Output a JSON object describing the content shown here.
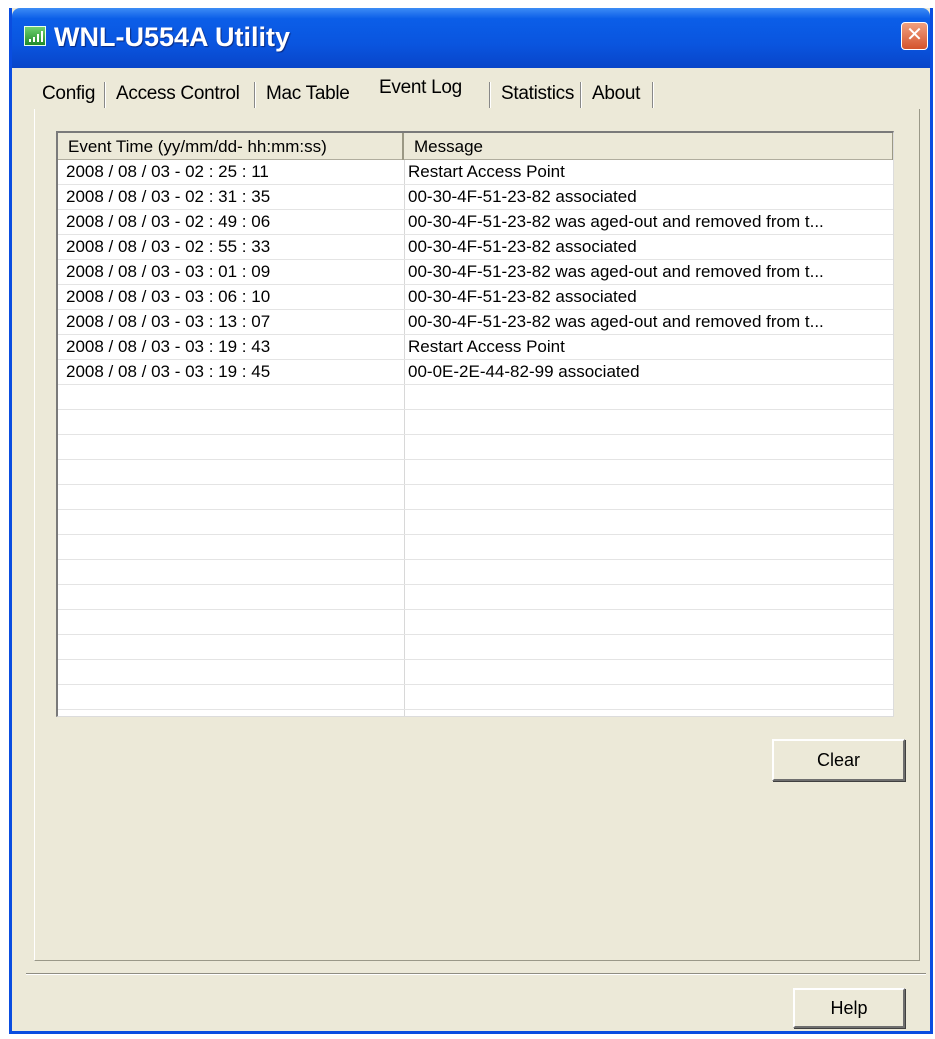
{
  "window": {
    "title": "WNL-U554A Utility",
    "close_glyph": "✕"
  },
  "tabs": [
    {
      "label": "Config"
    },
    {
      "label": "Access Control"
    },
    {
      "label": "Mac Table"
    },
    {
      "label": "Event Log",
      "active": true
    },
    {
      "label": "Statistics"
    },
    {
      "label": "About"
    }
  ],
  "event_log": {
    "columns": [
      "Event Time (yy/mm/dd- hh:mm:ss)",
      "Message"
    ],
    "rows": [
      {
        "time": "2008 / 08 / 03 - 02 : 25 : 11",
        "message": "Restart Access Point"
      },
      {
        "time": "2008 / 08 / 03 - 02 : 31 : 35",
        "message": "00-30-4F-51-23-82  associated"
      },
      {
        "time": "2008 / 08 / 03 - 02 : 49 : 06",
        "message": "00-30-4F-51-23-82  was aged-out and removed from t..."
      },
      {
        "time": "2008 / 08 / 03 - 02 : 55 : 33",
        "message": "00-30-4F-51-23-82  associated"
      },
      {
        "time": "2008 / 08 / 03 - 03 : 01 : 09",
        "message": "00-30-4F-51-23-82  was aged-out and removed from t..."
      },
      {
        "time": "2008 / 08 / 03 - 03 : 06 : 10",
        "message": "00-30-4F-51-23-82  associated"
      },
      {
        "time": "2008 / 08 / 03 - 03 : 13 : 07",
        "message": "00-30-4F-51-23-82  was aged-out and removed from t..."
      },
      {
        "time": "2008 / 08 / 03 - 03 : 19 : 43",
        "message": "Restart Access Point"
      },
      {
        "time": "2008 / 08 / 03 - 03 : 19 : 45",
        "message": "00-0E-2E-44-82-99 associated"
      }
    ],
    "total_rows": 22
  },
  "buttons": {
    "clear": "Clear",
    "help": "Help"
  },
  "colors": {
    "titlebar": "#0a55df",
    "window_bg": "#ece9d8",
    "close_button": "#d4532c"
  },
  "icons": {
    "app": "signal-bars-icon",
    "close": "close-icon"
  }
}
